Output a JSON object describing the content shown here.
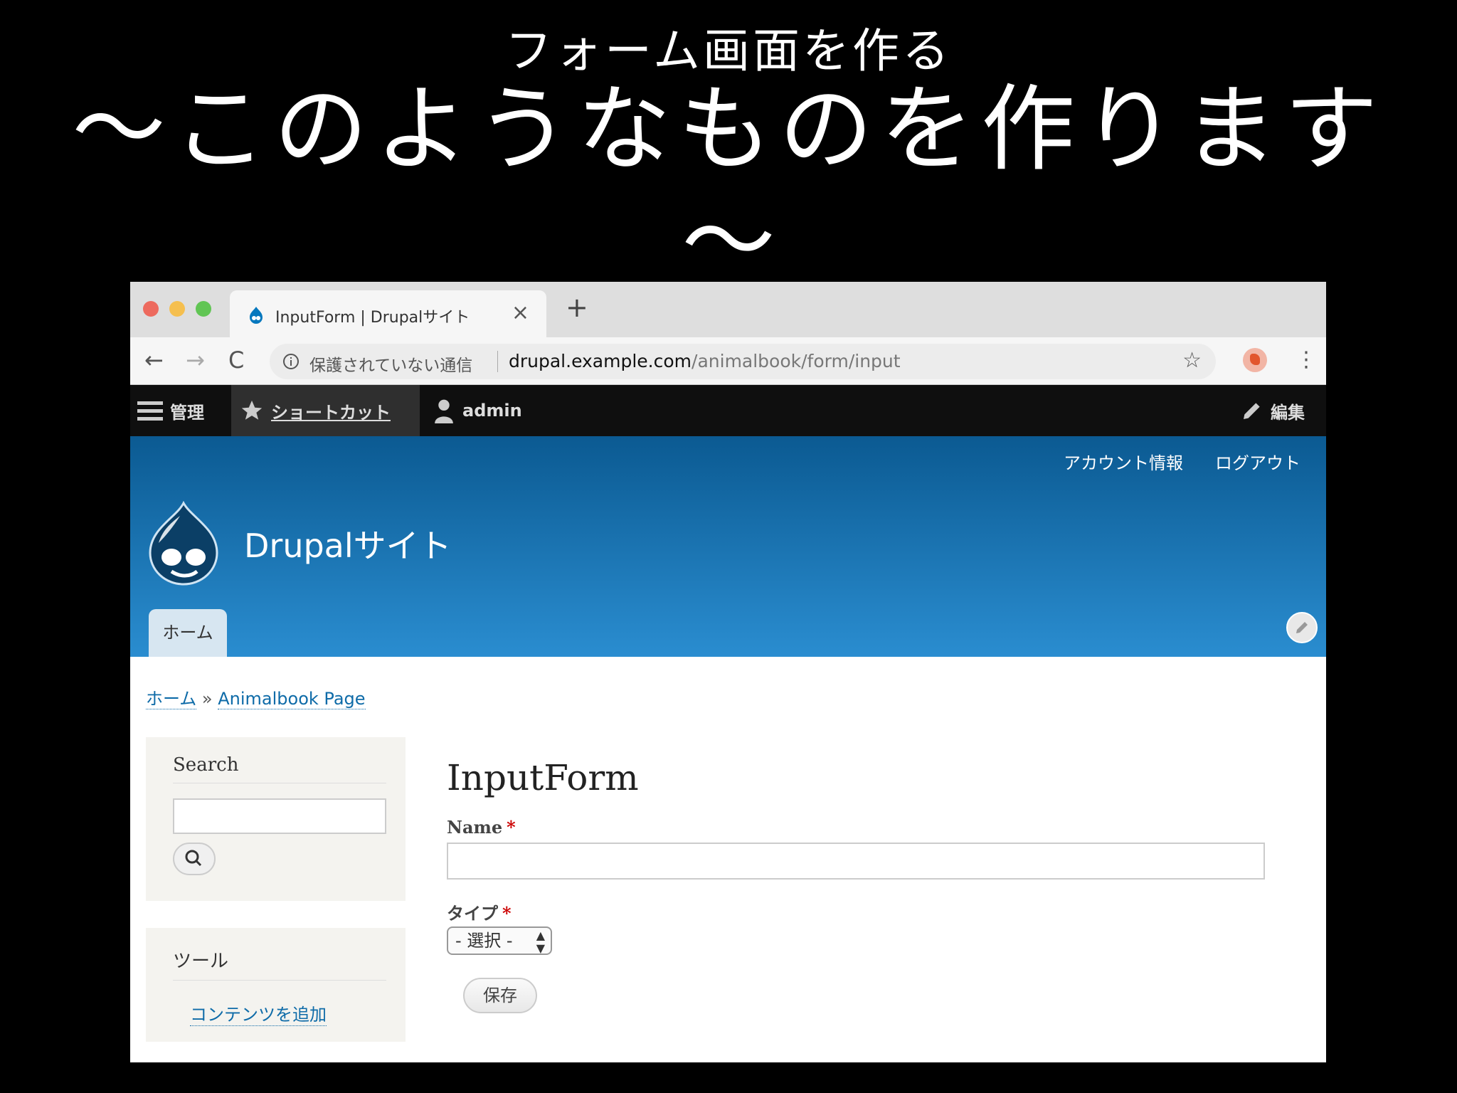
{
  "slide": {
    "subtitle": "フォーム画面を作る",
    "title": "～このようなものを作ります",
    "title_tail": "～"
  },
  "browser": {
    "tab_title": "InputForm | Drupalサイト",
    "tab_close": "×",
    "new_tab": "+",
    "back": "←",
    "forward": "→",
    "reload": "C",
    "security_text": "保護されていない通信",
    "url_host": "drupal.example.com",
    "url_path": "/animalbook/form/input",
    "star": "☆",
    "menu": "⋮"
  },
  "toolbar": {
    "manage": "管理",
    "shortcuts": "ショートカット",
    "user": "admin",
    "edit": "編集"
  },
  "header": {
    "account": "アカウント情報",
    "logout": "ログアウト",
    "site_name": "Drupalサイト",
    "home_tab": "ホーム"
  },
  "breadcrumb": {
    "home": "ホーム",
    "separator": "»",
    "page": "Animalbook Page"
  },
  "sidebar": {
    "search_title": "Search",
    "tools_title": "ツール",
    "add_content": "コンテンツを追加"
  },
  "form": {
    "title": "InputForm",
    "name_label": "Name",
    "required_mark": "*",
    "type_label": "タイプ",
    "type_selected": "- 選択 -",
    "save": "保存"
  },
  "colors": {
    "header_top": "#0b5a92",
    "header_bottom": "#2a8dd0",
    "link": "#0e6ba8",
    "required": "#cc0000"
  }
}
